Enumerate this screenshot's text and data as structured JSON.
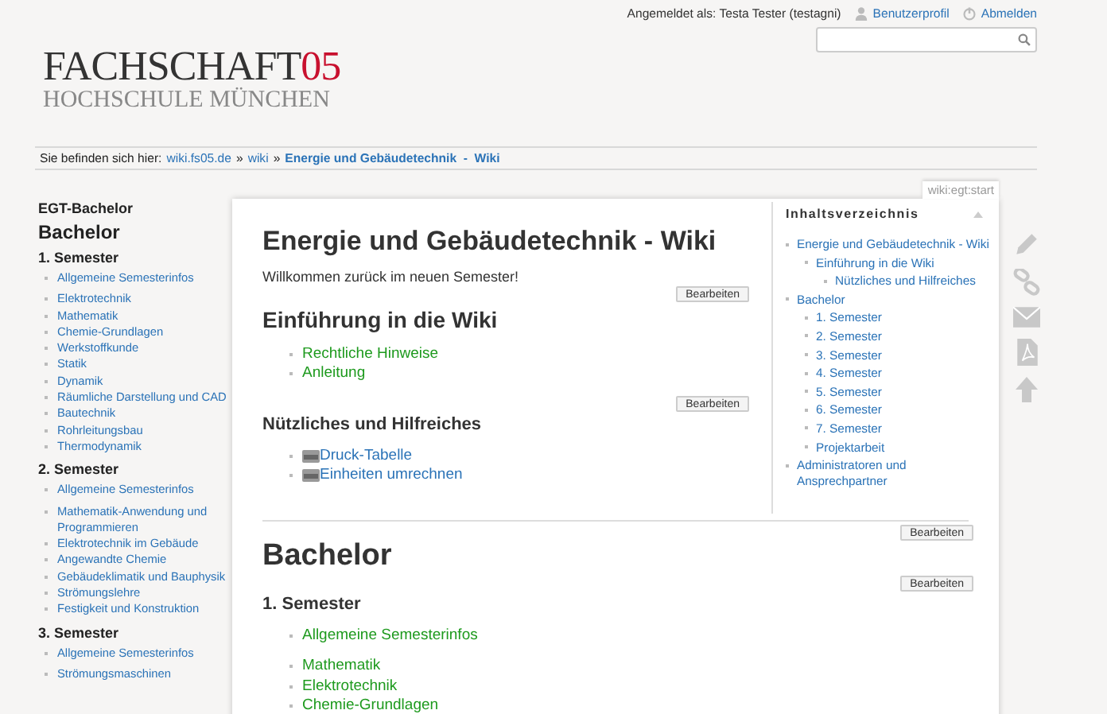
{
  "user_bar": {
    "logged_in_as": "Angemeldet als: Testa Tester (testagni)",
    "profile_link": "Benutzerprofil",
    "logout_link": "Abmelden"
  },
  "logo": {
    "name": "FACHSCHAFT",
    "number": "05",
    "subtitle": "HOCHSCHULE MÜNCHEN"
  },
  "breadcrumb": {
    "label": "Sie befinden sich hier:",
    "separator": "»",
    "items": [
      {
        "label": "wiki.fs05.de",
        "current": false
      },
      {
        "label": "wiki",
        "current": false
      },
      {
        "label": "Energie und Gebäudetechnik  -  Wiki",
        "current": true
      }
    ]
  },
  "sidebar": {
    "title": "EGT-Bachelor",
    "heading": "Bachelor",
    "groups": [
      {
        "heading": "1. Semester",
        "lists": [
          [
            "Allgemeine Semesterinfos"
          ],
          [
            "Elektrotechnik",
            "Mathematik",
            "Chemie-Grundlagen",
            "Werkstoffkunde",
            "Statik",
            "Dynamik",
            "Räumliche Darstellung und CAD",
            "Bautechnik",
            "Rohrleitungsbau",
            "Thermodynamik"
          ]
        ]
      },
      {
        "heading": "2. Semester",
        "lists": [
          [
            "Allgemeine Semesterinfos"
          ],
          [
            "Mathematik-Anwendung und Programmieren",
            "Elektrotechnik im Gebäude",
            "Angewandte Chemie",
            "Gebäudeklimatik und Bauphysik",
            "Strömungslehre",
            "Festigkeit und Konstruktion"
          ]
        ]
      },
      {
        "heading": "3. Semester",
        "lists": [
          [
            "Allgemeine Semesterinfos"
          ],
          [
            "Strömungsmaschinen"
          ]
        ]
      }
    ]
  },
  "page_id": "wiki:egt:start",
  "content_top": [
    {
      "kind": "h1",
      "text": "Energie und Gebäudetechnik - Wiki"
    },
    {
      "kind": "text",
      "text": "Willkommen zurück im neuen Semester!"
    },
    {
      "kind": "edit",
      "text": "Bearbeiten"
    },
    {
      "kind": "h2",
      "text": "Einführung in die Wiki"
    },
    {
      "kind": "links",
      "items": [
        {
          "kind": "page",
          "label": "Rechtliche Hinweise"
        },
        {
          "kind": "page",
          "label": "Anleitung"
        }
      ]
    },
    {
      "kind": "edit",
      "text": "Bearbeiten"
    },
    {
      "kind": "h3",
      "text": "Nützliches und Hilfreiches"
    },
    {
      "kind": "links",
      "items": [
        {
          "kind": "file",
          "label": "Druck-Tabelle"
        },
        {
          "kind": "file",
          "label": "Einheiten umrechnen"
        }
      ]
    }
  ],
  "toc": {
    "title": "Inhaltsverzeichnis",
    "items": [
      {
        "label": "Energie und Gebäudetechnik - Wiki",
        "children": [
          {
            "label": "Einführung in die Wiki",
            "children": [
              {
                "label": "Nützliches und Hilfreiches"
              }
            ]
          }
        ]
      },
      {
        "label": "Bachelor",
        "children": [
          {
            "label": "1. Semester"
          },
          {
            "label": "2. Semester"
          },
          {
            "label": "3. Semester"
          },
          {
            "label": "4. Semester"
          },
          {
            "label": "5. Semester"
          },
          {
            "label": "6. Semester"
          },
          {
            "label": "7. Semester"
          },
          {
            "label": "Projektarbeit"
          }
        ]
      },
      {
        "label": "Administratoren und Ansprechpartner"
      }
    ]
  },
  "content_bottom": [
    {
      "kind": "edit",
      "text": "Bearbeiten"
    },
    {
      "kind": "h1b",
      "text": "Bachelor"
    },
    {
      "kind": "edit",
      "text": "Bearbeiten"
    },
    {
      "kind": "h3",
      "text": "1. Semester"
    },
    {
      "kind": "links",
      "items": [
        {
          "kind": "page",
          "label": "Allgemeine Semesterinfos"
        }
      ]
    },
    {
      "kind": "links",
      "items": [
        {
          "kind": "page",
          "label": "Mathematik"
        },
        {
          "kind": "page",
          "label": "Elektrotechnik"
        },
        {
          "kind": "page",
          "label": "Chemie-Grundlagen"
        }
      ]
    }
  ]
}
